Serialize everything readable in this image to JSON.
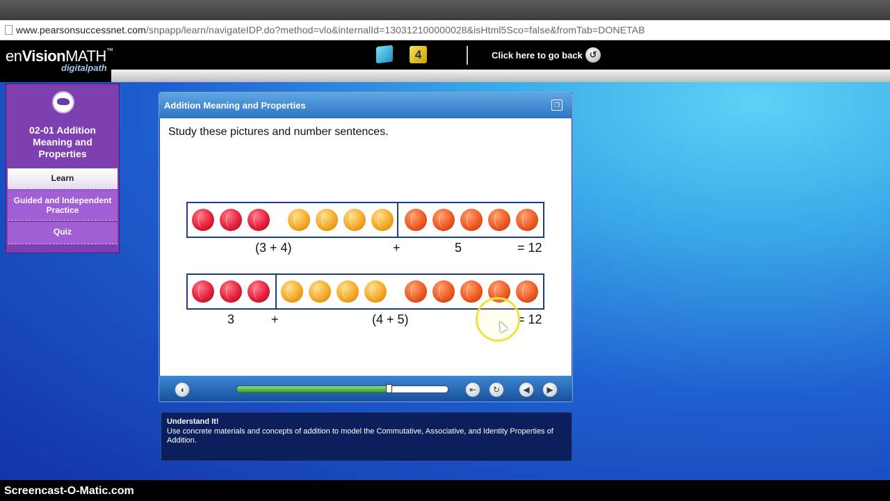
{
  "browser": {
    "url_host": "www.pearsonsuccessnet.com",
    "url_path": "/snpapp/learn/navigateIDP.do?method=vlo&internalId=130312100000028&isHtml5Sco=false&fromTab=DONETAB"
  },
  "header": {
    "logo_prefix": "en",
    "logo_brand": "Vision",
    "logo_suffix": "MATH",
    "logo_tm": "™",
    "logo_sub": "digitalpath",
    "tool_b_label": "4",
    "go_back_label": "Click here to go back",
    "go_back_icon": "refresh-icon"
  },
  "sidebar": {
    "lesson_title": "02-01 Addition Meaning and Properties",
    "items": [
      {
        "label": "Learn",
        "active": true
      },
      {
        "label": "Guided and Independent Practice",
        "active": false
      },
      {
        "label": "Quiz",
        "active": false
      }
    ]
  },
  "activity": {
    "title": "Addition Meaning and Properties",
    "instruction": "Study these pictures and number sentences.",
    "row1": {
      "groups": {
        "red": 3,
        "yellow": 4,
        "orange": 5
      },
      "eq_group": "(3 + 4)",
      "eq_plus": "+",
      "eq_single": "5",
      "eq_result": "= 12"
    },
    "row2": {
      "groups": {
        "red": 3,
        "yellow": 4,
        "orange": 5
      },
      "eq_single": "3",
      "eq_plus": "+",
      "eq_group": "(4 + 5)",
      "eq_result": "= 12"
    },
    "progress": 0.72,
    "colors": {
      "red": "#e3203a",
      "yellow": "#f4a92a",
      "orange": "#ee5a23"
    }
  },
  "understand": {
    "title": "Understand It!",
    "text": "Use concrete materials and concepts of addition to model the Commutative, Associative, and Identity Properties of Addition."
  },
  "watermark": "Screencast-O-Matic.com"
}
